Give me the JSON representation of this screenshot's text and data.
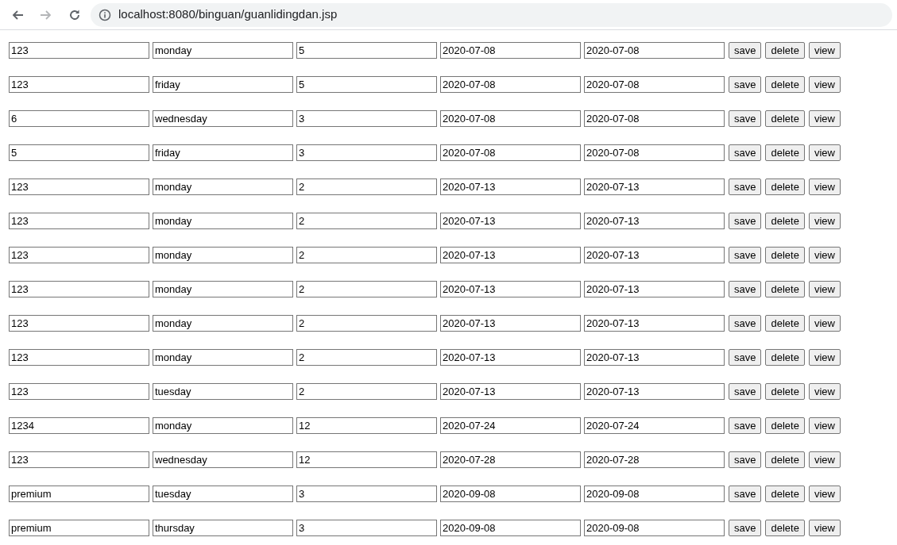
{
  "browser": {
    "nav_buttons": [
      {
        "kind": "back",
        "disabled": false
      },
      {
        "kind": "forward",
        "disabled": true
      },
      {
        "kind": "reload",
        "disabled": false
      }
    ],
    "url": "localhost:8080/binguan/guanlidingdan.jsp"
  },
  "rows": [
    {
      "fields": [
        "123",
        "monday",
        "5",
        "2020-07-08",
        "2020-07-08"
      ],
      "buttons": [
        "save",
        "delete",
        "view"
      ]
    },
    {
      "fields": [
        "123",
        "friday",
        "5",
        "2020-07-08",
        "2020-07-08"
      ],
      "buttons": [
        "save",
        "delete",
        "view"
      ]
    },
    {
      "fields": [
        "6",
        "wednesday",
        "3",
        "2020-07-08",
        "2020-07-08"
      ],
      "buttons": [
        "save",
        "delete",
        "view"
      ]
    },
    {
      "fields": [
        "5",
        "friday",
        "3",
        "2020-07-08",
        "2020-07-08"
      ],
      "buttons": [
        "save",
        "delete",
        "view"
      ]
    },
    {
      "fields": [
        "123",
        "monday",
        "2",
        "2020-07-13",
        "2020-07-13"
      ],
      "buttons": [
        "save",
        "delete",
        "view"
      ]
    },
    {
      "fields": [
        "123",
        "monday",
        "2",
        "2020-07-13",
        "2020-07-13"
      ],
      "buttons": [
        "save",
        "delete",
        "view"
      ]
    },
    {
      "fields": [
        "123",
        "monday",
        "2",
        "2020-07-13",
        "2020-07-13"
      ],
      "buttons": [
        "save",
        "delete",
        "view"
      ]
    },
    {
      "fields": [
        "123",
        "monday",
        "2",
        "2020-07-13",
        "2020-07-13"
      ],
      "buttons": [
        "save",
        "delete",
        "view"
      ]
    },
    {
      "fields": [
        "123",
        "monday",
        "2",
        "2020-07-13",
        "2020-07-13"
      ],
      "buttons": [
        "save",
        "delete",
        "view"
      ]
    },
    {
      "fields": [
        "123",
        "monday",
        "2",
        "2020-07-13",
        "2020-07-13"
      ],
      "buttons": [
        "save",
        "delete",
        "view"
      ]
    },
    {
      "fields": [
        "123",
        "tuesday",
        "2",
        "2020-07-13",
        "2020-07-13"
      ],
      "buttons": [
        "save",
        "delete",
        "view"
      ]
    },
    {
      "fields": [
        "1234",
        "monday",
        "12",
        "2020-07-24",
        "2020-07-24"
      ],
      "buttons": [
        "save",
        "delete",
        "view"
      ]
    },
    {
      "fields": [
        "123",
        "wednesday",
        "12",
        "2020-07-28",
        "2020-07-28"
      ],
      "buttons": [
        "save",
        "delete",
        "view"
      ]
    },
    {
      "fields": [
        "premium",
        "tuesday",
        "3",
        "2020-09-08",
        "2020-09-08"
      ],
      "buttons": [
        "save",
        "delete",
        "view"
      ]
    },
    {
      "fields": [
        "premium",
        "thursday",
        "3",
        "2020-09-08",
        "2020-09-08"
      ],
      "buttons": [
        "save",
        "delete",
        "view"
      ]
    }
  ]
}
